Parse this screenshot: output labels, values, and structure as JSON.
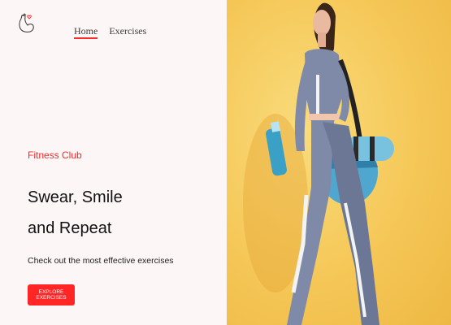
{
  "nav": {
    "items": [
      {
        "label": "Home",
        "active": true
      },
      {
        "label": "Exercises",
        "active": false
      }
    ]
  },
  "hero": {
    "tagline": "Fitness Club",
    "headline_line1": "Swear, Smile",
    "headline_line2": "and Repeat",
    "subtitle": "Check out the most effective exercises",
    "cta_label": "EXPLORE EXERCISES",
    "image_icon": "woman-with-gym-bag-photo"
  },
  "colors": {
    "accent": "#ff2625",
    "background": "#fdf6f7",
    "hero_background": "#f5c757"
  },
  "logo_icon": "flexing-arm-heart-icon"
}
